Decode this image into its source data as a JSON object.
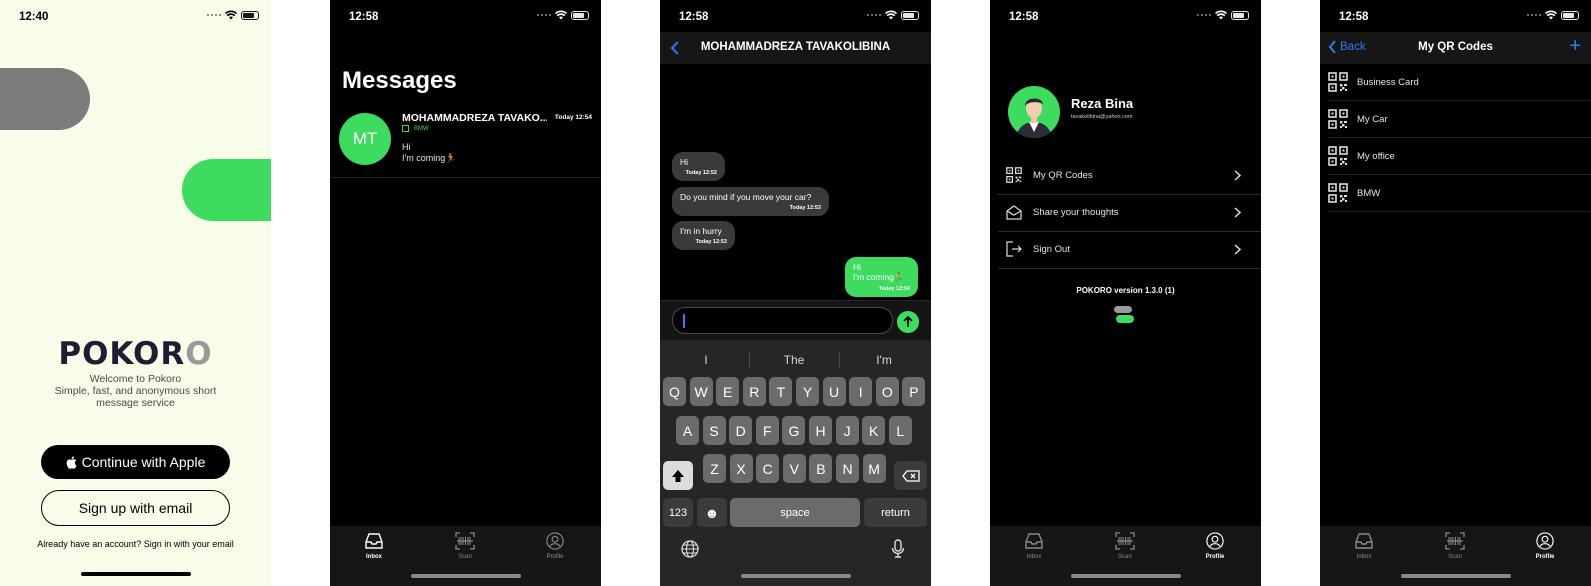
{
  "colors": {
    "accent_green": "#3ddc5f",
    "ios_blue": "#2f7cf6",
    "bg_dark": "#000000",
    "bg_light": "#f8fde9"
  },
  "login": {
    "time": "12:40",
    "logo_text": "POKORO",
    "welcome_line1": "Welcome to Pokoro",
    "welcome_line2": "Simple, fast, and anonymous short message service",
    "apple_button": "Continue with Apple",
    "email_button": "Sign up with email",
    "signin_text": "Already have an account? Sign in with your email"
  },
  "inbox": {
    "time": "12:58",
    "title": "Messages",
    "conversations": [
      {
        "initials": "MT",
        "name": "MOHAMMADREZA TAVAKO...",
        "tag": "BMW",
        "time": "Today 12:54",
        "line1": "Hi",
        "line2": "I'm coming🏃"
      }
    ]
  },
  "tabs": {
    "inbox": "Inbox",
    "scan": "Scan",
    "profile": "Profile"
  },
  "chat": {
    "time": "12:58",
    "title": "MOHAMMADREZA TAVAKOLIBINA",
    "messages": [
      {
        "dir": "in",
        "text": "Hi",
        "time": "Today 12:52"
      },
      {
        "dir": "in",
        "text": "Do you mind if you move your car?",
        "time": "Today 12:53"
      },
      {
        "dir": "in",
        "text": "I'm in hurry",
        "time": "Today 12:53"
      },
      {
        "dir": "out",
        "text": "Hi",
        "text2": "I'm coming🏃",
        "time": "Today 12:54"
      }
    ],
    "suggestions": [
      "I",
      "The",
      "I'm"
    ],
    "keys_row1": [
      "Q",
      "W",
      "E",
      "R",
      "T",
      "Y",
      "U",
      "I",
      "O",
      "P"
    ],
    "keys_row2": [
      "A",
      "S",
      "D",
      "F",
      "G",
      "H",
      "J",
      "K",
      "L"
    ],
    "keys_row3": [
      "Z",
      "X",
      "C",
      "V",
      "B",
      "N",
      "M"
    ],
    "key_123": "123",
    "key_emoji": "☻",
    "key_space": "space",
    "key_return": "return"
  },
  "profile": {
    "time": "12:58",
    "name": "Reza Bina",
    "email": "tavakolibina@yahoo.com",
    "menu": [
      {
        "label": "My QR Codes",
        "icon": "qr-code-icon"
      },
      {
        "label": "Share your thoughts",
        "icon": "envelope-open-icon"
      },
      {
        "label": "Sign Out",
        "icon": "sign-out-icon"
      }
    ],
    "version": "POKORO version 1.3.0 (1)"
  },
  "qrcodes": {
    "time": "12:58",
    "back_label": "Back",
    "title": "My QR Codes",
    "add_label": "+",
    "items": [
      "Business Card",
      "My Car",
      "My office",
      "BMW"
    ]
  }
}
